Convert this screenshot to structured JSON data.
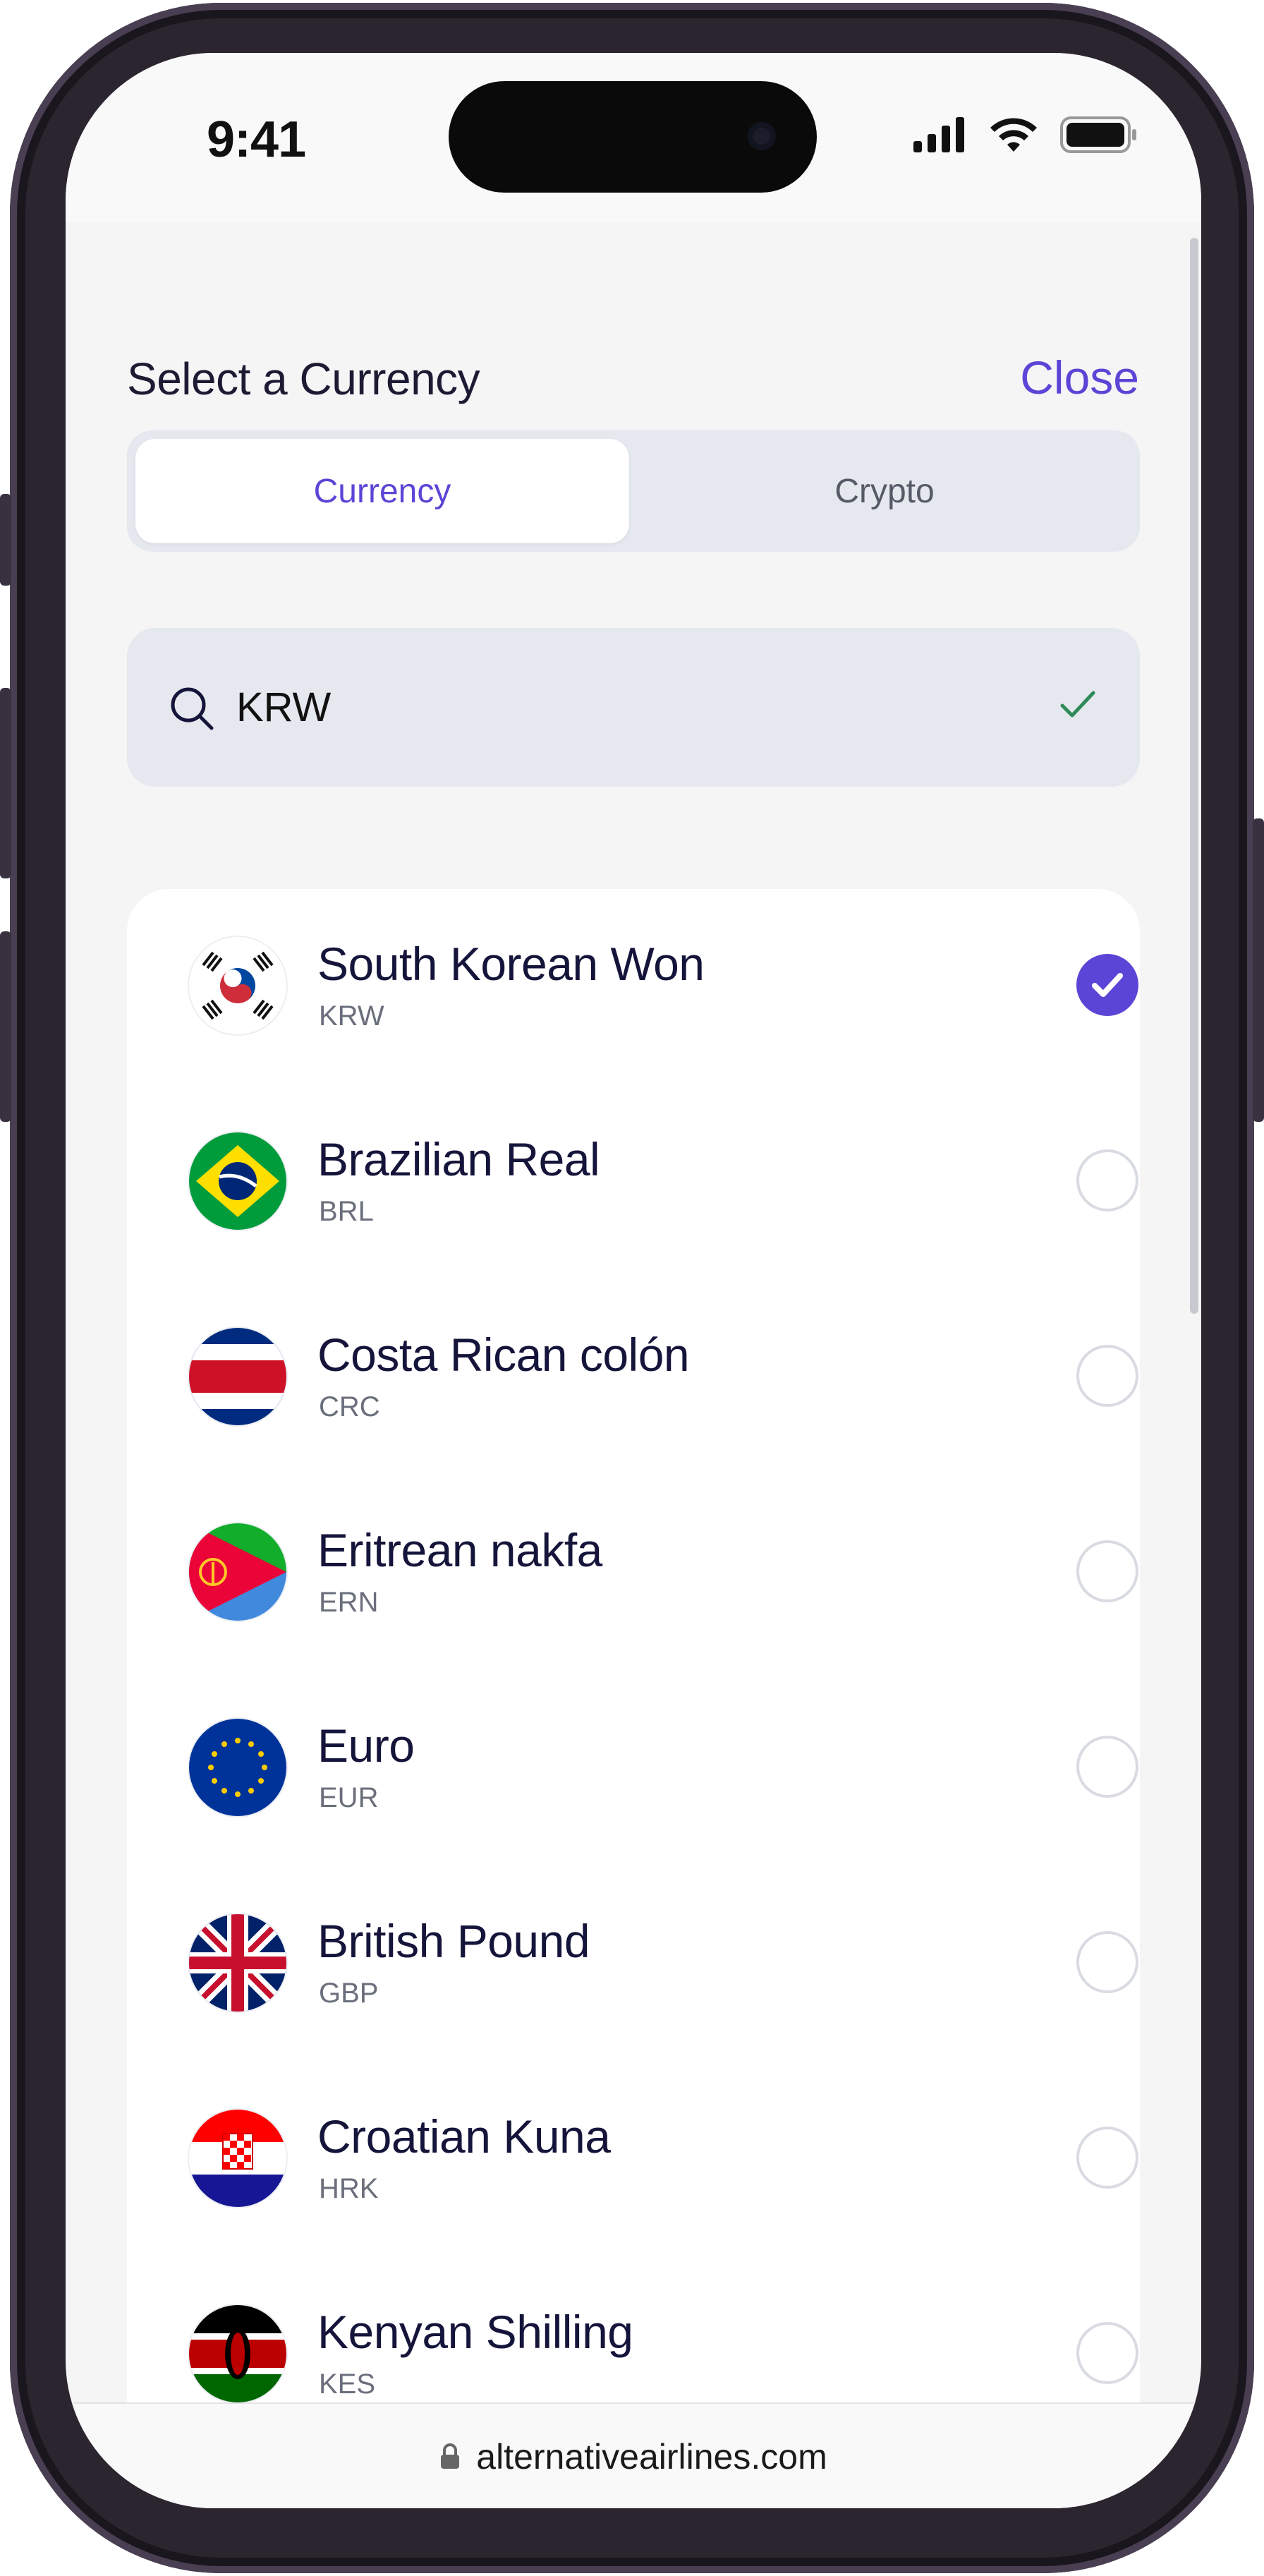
{
  "status_bar": {
    "time": "9:41"
  },
  "header": {
    "title": "Select a Currency",
    "close_label": "Close"
  },
  "tabs": [
    {
      "label": "Currency",
      "active": true
    },
    {
      "label": "Crypto",
      "active": false
    }
  ],
  "search": {
    "value": "KRW"
  },
  "currencies": [
    {
      "name": "South Korean Won",
      "code": "KRW",
      "selected": true
    },
    {
      "name": "Brazilian Real",
      "code": "BRL",
      "selected": false
    },
    {
      "name": "Costa Rican colón",
      "code": "CRC",
      "selected": false
    },
    {
      "name": "Eritrean nakfa",
      "code": "ERN",
      "selected": false
    },
    {
      "name": "Euro",
      "code": "EUR",
      "selected": false
    },
    {
      "name": "British Pound",
      "code": "GBP",
      "selected": false
    },
    {
      "name": "Croatian Kuna",
      "code": "HRK",
      "selected": false
    },
    {
      "name": "Kenyan Shilling",
      "code": "KES",
      "selected": false
    }
  ],
  "browser": {
    "url": "alternativeairlines.com"
  },
  "colors": {
    "accent": "#5b45d6",
    "text": "#1c1b33",
    "muted": "#6b6f7c",
    "field_bg": "#e6e8ef"
  }
}
